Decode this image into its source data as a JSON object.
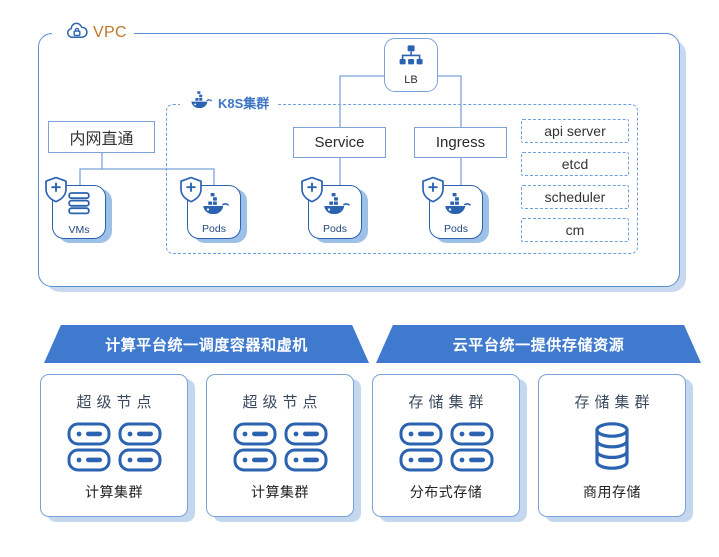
{
  "colors": {
    "accent_blue": "#3f7ace",
    "icon_blue": "#2c63b0",
    "border_blue": "#7ba3d9",
    "dashed_blue": "#6f9fdb",
    "vpc_label_orange": "#c0772a",
    "panel_shadow": "#c8d9ef"
  },
  "vpc": {
    "label": "VPC",
    "icon": "cloud-lock-icon"
  },
  "k8s": {
    "label": "K8S集群",
    "icon": "docker-whale-icon"
  },
  "nodes": {
    "intranet_box": "内网直通",
    "service_box": "Service",
    "ingress_box": "Ingress",
    "lb": {
      "label": "LB",
      "icon": "load-balancer-tree-icon"
    },
    "vms": {
      "label": "VMs",
      "icon": "server-stack-icon",
      "badge": "shield-plus-icon"
    },
    "pods": [
      {
        "label": "Pods",
        "icon": "docker-whale-icon",
        "badge": "shield-plus-icon"
      },
      {
        "label": "Pods",
        "icon": "docker-whale-icon",
        "badge": "shield-plus-icon"
      },
      {
        "label": "Pods",
        "icon": "docker-whale-icon",
        "badge": "shield-plus-icon"
      }
    ]
  },
  "control_plane": [
    {
      "label": "api server"
    },
    {
      "label": "etcd"
    },
    {
      "label": "scheduler"
    },
    {
      "label": "cm"
    }
  ],
  "banners": {
    "compute": "计算平台统一调度容器和虚机",
    "storage": "云平台统一提供存储资源"
  },
  "cards": [
    {
      "title": "超级节点",
      "sub": "计算集群",
      "icon": "server-rack-pair-icon"
    },
    {
      "title": "超级节点",
      "sub": "计算集群",
      "icon": "server-rack-pair-icon"
    },
    {
      "title": "存储集群",
      "sub": "分布式存储",
      "icon": "server-rack-pair-icon"
    },
    {
      "title": "存储集群",
      "sub": "商用存储",
      "icon": "database-cylinder-icon"
    }
  ]
}
